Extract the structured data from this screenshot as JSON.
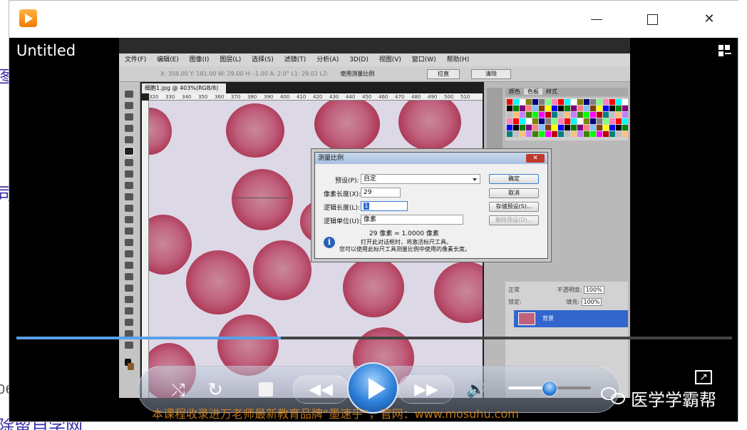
{
  "window": {
    "title": "Untitled",
    "close_glyph": "✕"
  },
  "photoshop": {
    "menu": [
      "文件(F)",
      "编辑(E)",
      "图像(I)",
      "图层(L)",
      "选择(S)",
      "滤镜(T)",
      "分析(A)",
      "3D(D)",
      "视图(V)",
      "窗口(W)",
      "帮助(H)"
    ],
    "options_bar": {
      "readout": "X: 358.00  Y: 181.00  W: 29.00  H: -1.00  A: 2.0°  L1: 29.02  L2:",
      "use_scale_label": "使用测量比例",
      "straighten_button": "拉直",
      "clear_button": "清除"
    },
    "doc_tab": "细胞1.jpg @ 403%(RGB/8)",
    "ruler_ticks": [
      "320",
      "330",
      "340",
      "350",
      "360",
      "370",
      "380",
      "390",
      "400",
      "410",
      "420",
      "430",
      "440",
      "450",
      "460",
      "470",
      "480",
      "490",
      "500",
      "510"
    ],
    "panel_tabs": [
      "颜色",
      "色板",
      "样式"
    ],
    "layers": {
      "mode": "正常",
      "opacity_label": "不透明度:",
      "opacity_value": "100%",
      "lock_label": "锁定:",
      "fill_label": "填充:",
      "fill_value": "100%",
      "layer_name": "背景"
    }
  },
  "dialog": {
    "title": "测量比例",
    "close_glyph": "✕",
    "preset_label": "预设(P):",
    "preset_value": "自定",
    "pixel_length_label": "像素长度(X):",
    "pixel_length_value": "29",
    "logical_length_label": "逻辑长度(L):",
    "logical_length_value": "1",
    "logical_units_label": "逻辑单位(U):",
    "logical_units_value": "像素",
    "ratio_text": "29 像素 = 1.0000 像素",
    "ok_button": "确定",
    "cancel_button": "取消",
    "save_preset_button": "存储预设(S)...",
    "delete_preset_button": "删除预设(D)...",
    "note_line1": "打开此对话框时，将激活标尺工具。",
    "note_line2": "您可以使用此标尺工具测量比例中使用的像素长度。"
  },
  "player": {
    "progress": 0.37,
    "volume": 0.5
  },
  "overlay": {
    "watermark": "本课程收录进万老师最新教育品牌“墨速乎”，官网：www.mosuhu.com",
    "brand": "医学学霸帮"
  },
  "colors": {
    "accent": "#2c7fd8",
    "layer_selected": "#3366cc",
    "cell": "#c0607d",
    "watermark": "#e08a1e"
  }
}
